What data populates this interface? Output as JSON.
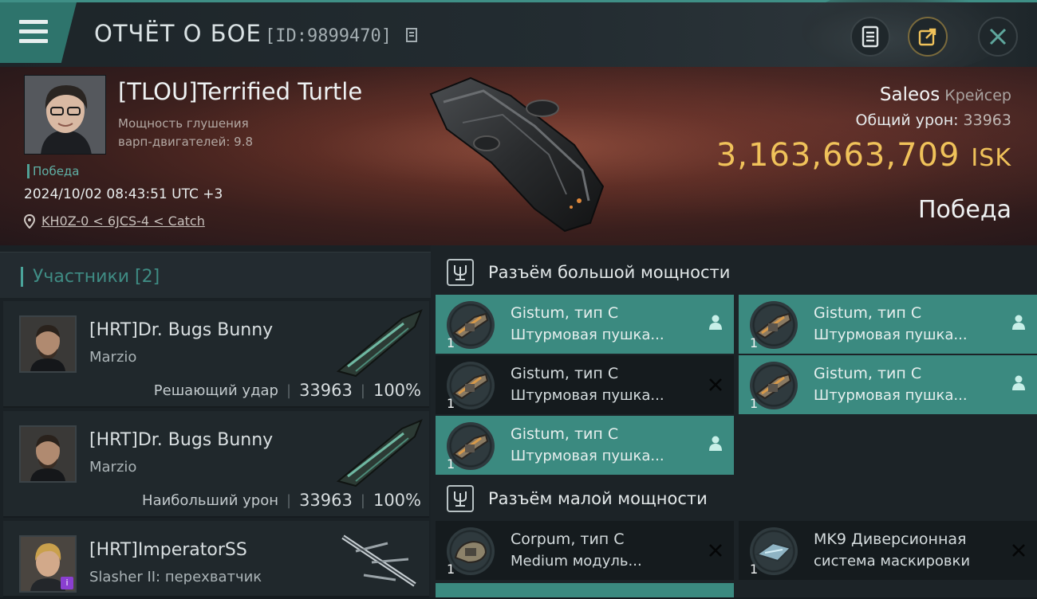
{
  "header": {
    "title": "ОТЧЁТ О БОЕ",
    "report_id": "[ID:9899470]"
  },
  "victim": {
    "name": "[TLOU]Terrified Turtle",
    "stat_line1": "Мощность глушения",
    "stat_line2": "варп-двигателей: 9.8",
    "status": "Победа",
    "timestamp": "2024/10/02 08:43:51 UTC +3",
    "route": "KH0Z-0 < 6JCS-4 < Catch",
    "ship_name": "Saleos",
    "ship_class": "Крейсер",
    "total_damage_label": "Общий урон:",
    "total_damage": "33963",
    "isk_value": "3,163,663,709",
    "isk_unit": "ISK",
    "result": "Победа"
  },
  "participants": {
    "tab_label": "Участники [2]",
    "rows": [
      {
        "name": "[HRT]Dr. Bugs Bunny",
        "ship": "Marzio",
        "role": "Решающий удар",
        "damage": "33963",
        "percent": "100%"
      },
      {
        "name": "[HRT]Dr. Bugs Bunny",
        "ship": "Marzio",
        "role": "Наибольший урон",
        "damage": "33963",
        "percent": "100%"
      },
      {
        "name": "[HRT]ImperatorSS",
        "ship": "Slasher II: перехватчик",
        "role": "",
        "damage": "",
        "percent": ""
      }
    ]
  },
  "fitting": {
    "high_title": "Разъём большой мощности",
    "low_title": "Разъём малой мощности",
    "high_slots": [
      {
        "qty": "1",
        "name": "Gistum, тип C",
        "desc": "Штурмовая пушка...",
        "state": "dropped"
      },
      {
        "qty": "1",
        "name": "Gistum, тип C",
        "desc": "Штурмовая пушка...",
        "state": "dropped"
      },
      {
        "qty": "1",
        "name": "Gistum, тип C",
        "desc": "Штурмовая пушка...",
        "state": "destroyed"
      },
      {
        "qty": "1",
        "name": "Gistum, тип C",
        "desc": "Штурмовая пушка...",
        "state": "dropped"
      },
      {
        "qty": "1",
        "name": "Gistum, тип C",
        "desc": "Штурмовая пушка...",
        "state": "dropped"
      }
    ],
    "low_slots": [
      {
        "qty": "1",
        "name": "Corpum, тип C",
        "desc": "Medium модуль...",
        "state": "destroyed"
      },
      {
        "qty": "1",
        "name": "MK9 Диверсионная",
        "desc": "система маскировки",
        "state": "destroyed"
      }
    ]
  },
  "colors": {
    "accent_teal": "#3b8a80",
    "isk_gold": "#f0c25a"
  }
}
